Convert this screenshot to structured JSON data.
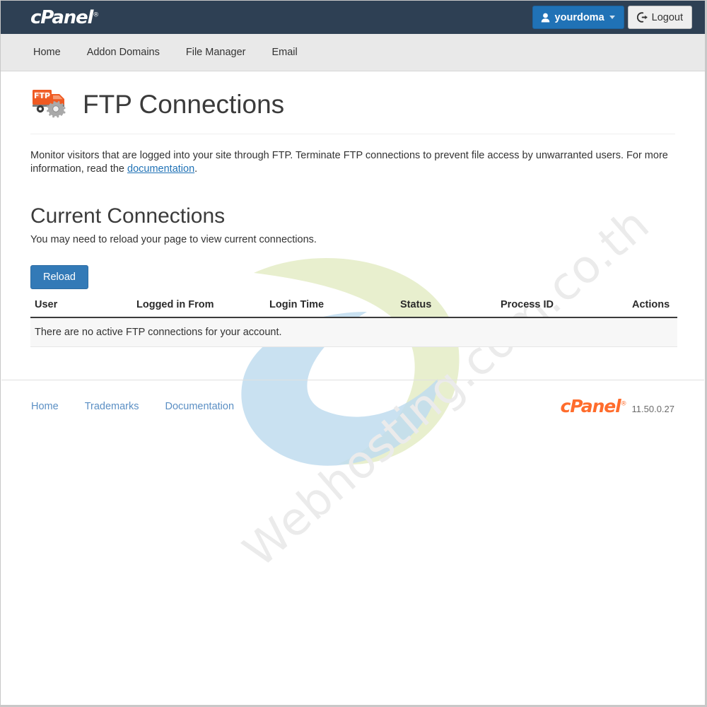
{
  "header": {
    "logo_text": "cPanel",
    "logo_registered": "®",
    "user_button_label": "yourdoma",
    "user_icon": "user-icon",
    "caret_icon": "chevron-down-icon",
    "logout_label": "Logout",
    "logout_icon": "logout-icon",
    "bar_color": "#2e4054",
    "user_button_color": "#2072b6"
  },
  "nav": {
    "items": [
      {
        "label": "Home"
      },
      {
        "label": "Addon Domains"
      },
      {
        "label": "File Manager"
      },
      {
        "label": "Email"
      }
    ]
  },
  "page": {
    "title": "FTP Connections",
    "icon": "ftp-truck-gear-icon",
    "description_part1": "Monitor visitors that are logged into your site through FTP. Terminate FTP connections to prevent file access by unwarranted users. For more information, read the ",
    "description_link": "documentation",
    "description_part2": "."
  },
  "current_connections": {
    "heading": "Current Connections",
    "subtext": "You may need to reload your page to view current connections.",
    "reload_button": "Reload",
    "reload_button_color": "#337ab7",
    "table": {
      "columns": [
        "User",
        "Logged in From",
        "Login Time",
        "Status",
        "Process ID",
        "Actions"
      ],
      "rows": [],
      "empty_message": "There are no active FTP connections for your account."
    }
  },
  "footer": {
    "links": [
      {
        "label": "Home"
      },
      {
        "label": "Trademarks"
      },
      {
        "label": "Documentation"
      }
    ],
    "brand": "cPanel",
    "brand_registered": "®",
    "version": "11.50.0.27",
    "brand_color": "#ff6c2c"
  },
  "watermark": {
    "text": "Webhosting.com.co.th",
    "logo": "leaf-swirl-logo"
  }
}
